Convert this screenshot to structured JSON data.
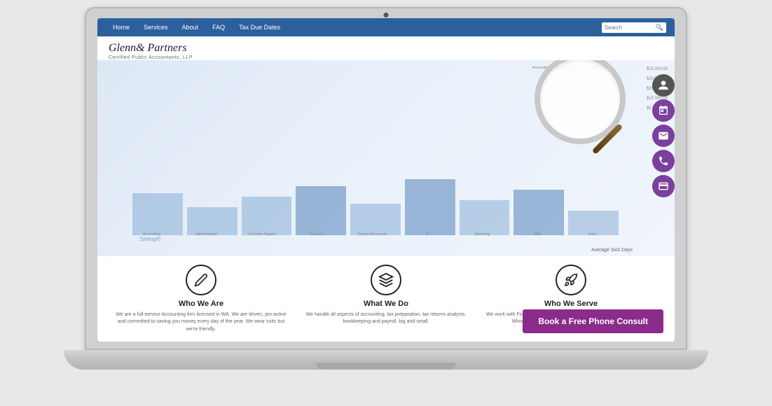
{
  "laptop": {
    "camera_label": "camera"
  },
  "nav": {
    "items": [
      "Home",
      "Services",
      "About",
      "FAQ",
      "Tax Due Dates"
    ],
    "search_placeholder": "Search"
  },
  "header": {
    "brand_name": "Glenn",
    "brand_name_italic": "& Partners",
    "tagline": "Certified Public Accountants, LLP"
  },
  "chart": {
    "y_labels": [
      "$25 000,00",
      "$20 000,00",
      "$15 000,00",
      "$10 000,00",
      "$5 000,00"
    ],
    "x_label": "Average Sick Days",
    "strength_label": "Strength",
    "x_axis_value": "4.5",
    "categories": [
      "Accounting",
      "Administration",
      "Customer Support",
      "Finance",
      "Human Resources",
      "IT",
      "Marketing",
      "R&D",
      "Sales"
    ],
    "bar_heights": [
      60,
      40,
      55,
      70,
      45,
      80,
      50,
      65,
      35
    ]
  },
  "services": [
    {
      "title": "Who We Are",
      "description": "We are a full-service Accounting firm licensed in WA. We are driven, pro-active and committed to saving you money every day of the year. We wear suits but we're friendly.",
      "icon": "✏"
    },
    {
      "title": "What We Do",
      "description": "We handle all aspects of accounting, tax preparation, tax returns analysis, bookkeeping and payroll, big and small.",
      "icon": "⊞"
    },
    {
      "title": "Who We Serve",
      "description": "We work with Fortune 500's, startups, mom and pop shops, and solopreneurs. Whoever you are & whatever financial goals you have.",
      "icon": "🚀"
    }
  ],
  "cta": {
    "label": "Book a Free Phone Consult"
  },
  "floating_icons": [
    {
      "name": "user-icon",
      "symbol": "👤"
    },
    {
      "name": "calendar-icon",
      "symbol": "📅"
    },
    {
      "name": "email-icon",
      "symbol": "✉"
    },
    {
      "name": "phone-icon",
      "symbol": "📞"
    },
    {
      "name": "card-icon",
      "symbol": "💳"
    }
  ]
}
